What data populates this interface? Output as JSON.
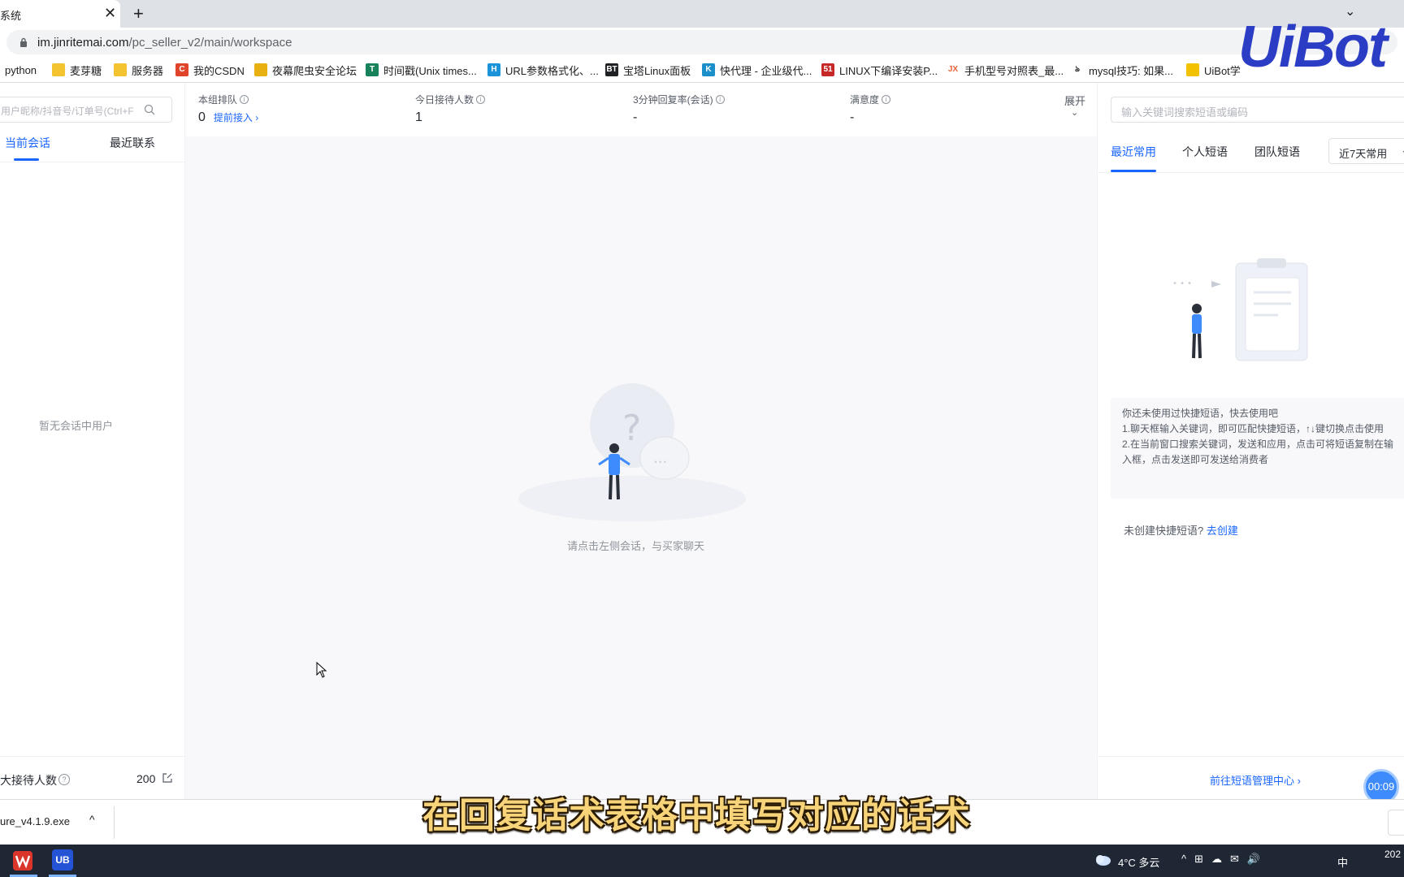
{
  "browser": {
    "tab_title": "系统",
    "tab_close": "✕",
    "new_tab": "+",
    "tab_menu": "⌄",
    "url_host": "im.jinritemai.com",
    "url_path": "/pc_seller_v2/main/workspace",
    "bookmarks": [
      {
        "label": "python",
        "icon": "none"
      },
      {
        "label": "麦芽糖",
        "icon": "folder-icon"
      },
      {
        "label": "服务器",
        "icon": "folder-icon"
      },
      {
        "label": "我的CSDN",
        "icon": "csdn-icon"
      },
      {
        "label": "夜幕爬虫安全论坛",
        "icon": "trophy-icon"
      },
      {
        "label": "时间戳(Unix times...",
        "icon": "t-icon"
      },
      {
        "label": "URL参数格式化、...",
        "icon": "h-icon"
      },
      {
        "label": "宝塔Linux面板",
        "icon": "bt-icon"
      },
      {
        "label": "快代理 - 企业级代...",
        "icon": "k-icon"
      },
      {
        "label": "LINUX下编译安装P...",
        "icon": "51-icon"
      },
      {
        "label": "手机型号对照表_最...",
        "icon": "jx-icon"
      },
      {
        "label": "mysql技巧: 如果...",
        "icon": "fork-icon"
      },
      {
        "label": "UiBot学",
        "icon": "uibot-icon"
      }
    ],
    "overlay_logo": "UiBot"
  },
  "left_panel": {
    "search_placeholder": "用户昵称/抖音号/订单号(Ctrl+F",
    "tabs": [
      "当前会话",
      "最近联系"
    ],
    "empty_text": "暂无会话中用户",
    "max_label": "大接待人数",
    "help_mark": "?",
    "max_value": "200"
  },
  "stats": {
    "items": [
      {
        "label": "本组排队",
        "value": "0",
        "link": "提前接入 ›"
      },
      {
        "label": "今日接待人数",
        "value": "1"
      },
      {
        "label": "3分钟回复率(会话)",
        "value": "-"
      },
      {
        "label": "满意度",
        "value": "-"
      }
    ],
    "expand_label": "展开",
    "expand_chevron": "⌄"
  },
  "center": {
    "empty_text": "请点击左侧会话，与买家聊天"
  },
  "right_panel": {
    "search_placeholder": "输入关键词搜索短语或编码",
    "tabs": [
      "最近常用",
      "个人短语",
      "团队短语"
    ],
    "range_select": "近7天常用",
    "range_chevron": "⌄",
    "tips": [
      "你还未使用过快捷短语，快去使用吧",
      "1.聊天框输入关键词，即可匹配快捷短语，↑↓键切换点击使用",
      "2.在当前窗口搜索关键词，发送和应用，点击可将短语复制在输入框，点击发送即可发送给消费者"
    ],
    "create_prompt": "未创建快捷短语?",
    "create_link": "去创建",
    "manage_link": "前往短语管理中心 ›",
    "timer": "00:09"
  },
  "download_bar": {
    "file_name": "ure_v4.1.9.exe",
    "chevron": "^"
  },
  "subtitle": "在回复话术表格中填写对应的话术",
  "taskbar": {
    "ub_label": "UB",
    "weather": "4°C  多云",
    "tray": [
      "^",
      "⊞",
      "☁",
      "✉",
      "🔊"
    ],
    "ime": "中",
    "clock": "202"
  }
}
